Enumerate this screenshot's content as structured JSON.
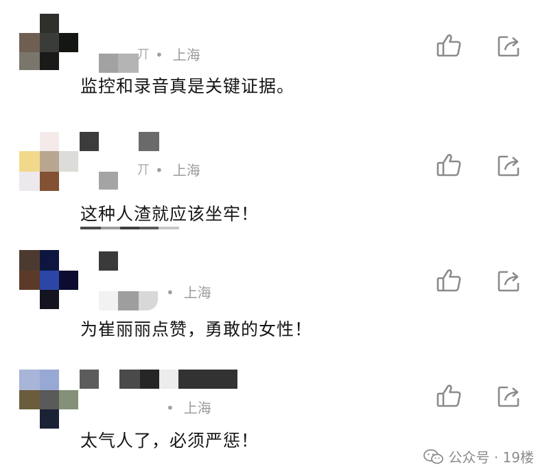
{
  "comments": [
    {
      "location": "上海",
      "text": "监控和录音真是关键证据。",
      "name_tail": "丌"
    },
    {
      "location": "上海",
      "text": "这种人渣就应该坐牢！",
      "name_tail": "丌"
    },
    {
      "location": "上海",
      "text": "为崔丽丽点赞，勇敢的女性！",
      "name_tail": ""
    },
    {
      "location": "上海",
      "text": "太气人了，必须严惩！",
      "name_tail": ""
    }
  ],
  "separator": "•",
  "icons": {
    "like": "thumbs-up-icon",
    "share": "share-icon",
    "brand": "wechat-icon"
  },
  "watermark": {
    "text": "公众号 · 19楼"
  },
  "colors": {
    "text": "#151515",
    "meta": "#9a9a9a",
    "icon": "#8a8a8a"
  }
}
